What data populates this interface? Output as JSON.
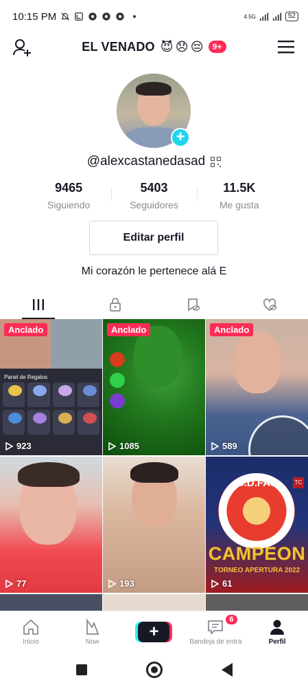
{
  "status_bar": {
    "time": "10:15 PM",
    "network": "4.5G",
    "battery": "52",
    "icons": [
      "mute-bell-icon",
      "nfc-icon",
      "chrome-icon",
      "chrome-icon",
      "chrome-icon",
      "dot-icon",
      "signal-icon",
      "signal-icon",
      "battery-icon"
    ]
  },
  "header": {
    "title": "EL VENADO",
    "emojis": [
      "😈",
      "😞",
      "😔"
    ],
    "badge": "9+",
    "left_icon": "add-user-icon",
    "right_icon": "hamburger-menu-icon"
  },
  "profile": {
    "username": "@alexcastanedasad",
    "stats": [
      {
        "value": "9465",
        "label": "Siguiendo"
      },
      {
        "value": "5403",
        "label": "Seguidores"
      },
      {
        "value": "11.5K",
        "label": "Me gusta"
      }
    ],
    "edit_button": "Editar perfil",
    "bio": "Mi corazón le pertenece alá E"
  },
  "tabs": [
    {
      "icon": "grid-videos-icon",
      "active": true
    },
    {
      "icon": "lock-icon",
      "active": false
    },
    {
      "icon": "bookmark-hidden-icon",
      "active": false
    },
    {
      "icon": "liked-hidden-icon",
      "active": false
    }
  ],
  "videos": [
    {
      "pinned": "Anclado",
      "views": "923",
      "overlay_text": "Panel de Regalos"
    },
    {
      "pinned": "Anclado",
      "views": "1085"
    },
    {
      "pinned": "Anclado",
      "views": "589"
    },
    {
      "pinned": "",
      "views": "77"
    },
    {
      "pinned": "",
      "views": "193"
    },
    {
      "pinned": "",
      "views": "61",
      "overlay_text": "C.D.FAS",
      "overlay_title": "CAMPEON",
      "overlay_sub": "TORNEO APERTURA 2022",
      "overlay_badge": "TC"
    }
  ],
  "bottom_nav": [
    {
      "label": "Inicio",
      "icon": "home-icon"
    },
    {
      "label": "Now",
      "icon": "now-icon"
    },
    {
      "label": "+",
      "icon": "create-icon"
    },
    {
      "label": "Bandeja de entra",
      "icon": "inbox-icon",
      "badge": "6"
    },
    {
      "label": "Perfil",
      "icon": "profile-icon",
      "active": true
    }
  ],
  "colors": {
    "accent": "#fe2c55",
    "cyan": "#20d5ec",
    "text": "#161823",
    "muted": "#8a8b91"
  }
}
